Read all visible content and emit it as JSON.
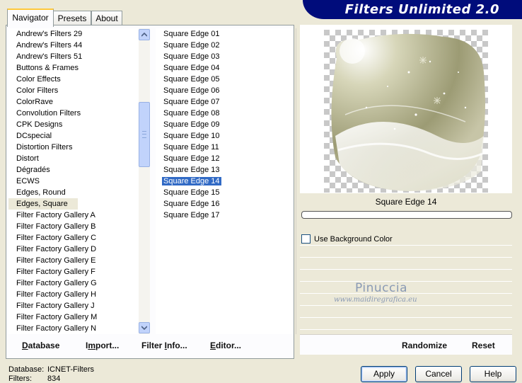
{
  "tabs": [
    {
      "label": "Navigator",
      "active": true
    },
    {
      "label": "Presets",
      "active": false
    },
    {
      "label": "About",
      "active": false
    }
  ],
  "banner": {
    "title": "Filters Unlimited 2.0",
    "color": "#000c7b"
  },
  "categories": [
    "Andrew's Filters 29",
    "Andrew's Filters 44",
    "Andrew's Filters 51",
    "Buttons & Frames",
    "Color Effects",
    "Color Filters",
    "ColorRave",
    "Convolution Filters",
    "CPK Designs",
    "DCspecial",
    "Distortion Filters",
    "Distort",
    "Dégradés",
    "ECWS",
    "Edges, Round",
    "Edges, Square",
    "Filter Factory Gallery A",
    "Filter Factory Gallery B",
    "Filter Factory Gallery C",
    "Filter Factory Gallery D",
    "Filter Factory Gallery E",
    "Filter Factory Gallery F",
    "Filter Factory Gallery G",
    "Filter Factory Gallery H",
    "Filter Factory Gallery J",
    "Filter Factory Gallery M",
    "Filter Factory Gallery N"
  ],
  "selected_category": "Edges, Square",
  "filters": [
    "Square Edge 01",
    "Square Edge 02",
    "Square Edge 03",
    "Square Edge 04",
    "Square Edge 05",
    "Square Edge 06",
    "Square Edge 07",
    "Square Edge 08",
    "Square Edge 09",
    "Square Edge 10",
    "Square Edge 11",
    "Square Edge 12",
    "Square Edge 13",
    "Square Edge 14",
    "Square Edge 15",
    "Square Edge 16",
    "Square Edge 17"
  ],
  "selected_filter": "Square Edge 14",
  "panel_buttons": {
    "database": {
      "u": "D",
      "rest": "atabase"
    },
    "import": {
      "pre": "I",
      "u": "m",
      "rest": "port..."
    },
    "filter_info": {
      "pre": "Filter ",
      "u": "I",
      "rest": "nfo..."
    },
    "editor": {
      "u": "E",
      "rest": "ditor..."
    }
  },
  "preview": {
    "label": "Square Edge 14",
    "use_bg_label": "Use Background Color",
    "use_bg_checked": false,
    "randomize_label": "Randomize",
    "reset_label": "Reset"
  },
  "watermark": {
    "line1": "Pinuccia",
    "line2": "www.maidiregrafica.eu"
  },
  "status": {
    "database_key": "Database:",
    "database_value": "ICNET-Filters",
    "filters_key": "Filters:",
    "filters_value": "834"
  },
  "dialog_buttons": {
    "apply": "Apply",
    "cancel": "Cancel",
    "help": "Help"
  }
}
